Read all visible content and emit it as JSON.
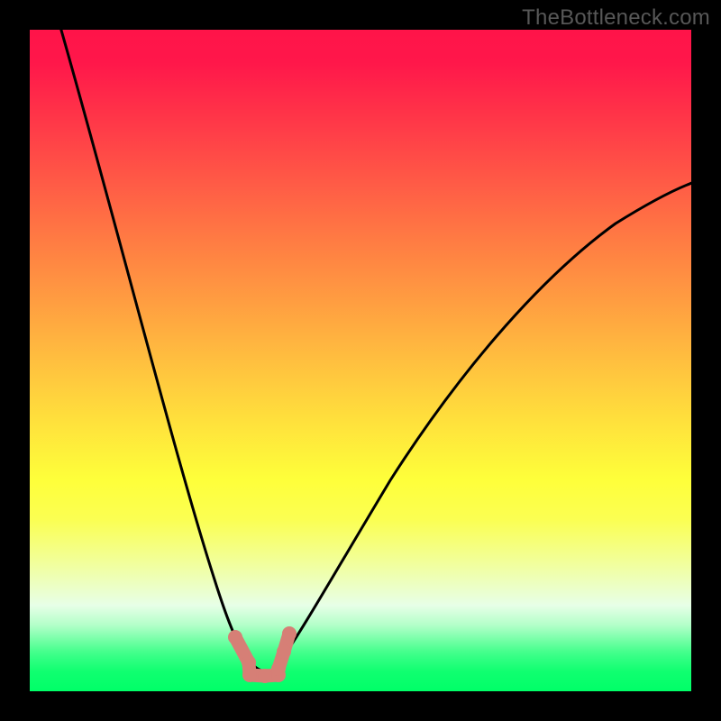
{
  "watermark": "TheBottleneck.com",
  "chart_data": {
    "type": "line",
    "title": "",
    "xlabel": "",
    "ylabel": "",
    "xlim": [
      0,
      100
    ],
    "ylim": [
      0,
      100
    ],
    "grid": false,
    "background": "vertical-heat-gradient",
    "gradient_stops": [
      {
        "pos": 0.0,
        "color": "#ff1449"
      },
      {
        "pos": 0.5,
        "color": "#ffbf3f"
      },
      {
        "pos": 0.68,
        "color": "#feff3a"
      },
      {
        "pos": 0.87,
        "color": "#e7ffe7"
      },
      {
        "pos": 1.0,
        "color": "#00ff68"
      }
    ],
    "series": [
      {
        "name": "bottleneck-curve",
        "color": "#000000",
        "x": [
          4,
          10,
          16,
          22,
          26,
          30,
          33,
          35,
          36,
          38,
          41,
          46,
          54,
          64,
          76,
          88,
          100
        ],
        "values": [
          100,
          72,
          46,
          25,
          14,
          7,
          4,
          3,
          3,
          4,
          8,
          18,
          34,
          51,
          64,
          73,
          78
        ]
      }
    ],
    "markers": {
      "name": "optimal-range",
      "color": "#d67f76",
      "x": [
        31,
        33,
        33,
        36,
        38,
        38,
        38,
        39
      ],
      "values": [
        8,
        5,
        3,
        3,
        3,
        3,
        6,
        9
      ]
    },
    "legend": null,
    "annotations": []
  }
}
